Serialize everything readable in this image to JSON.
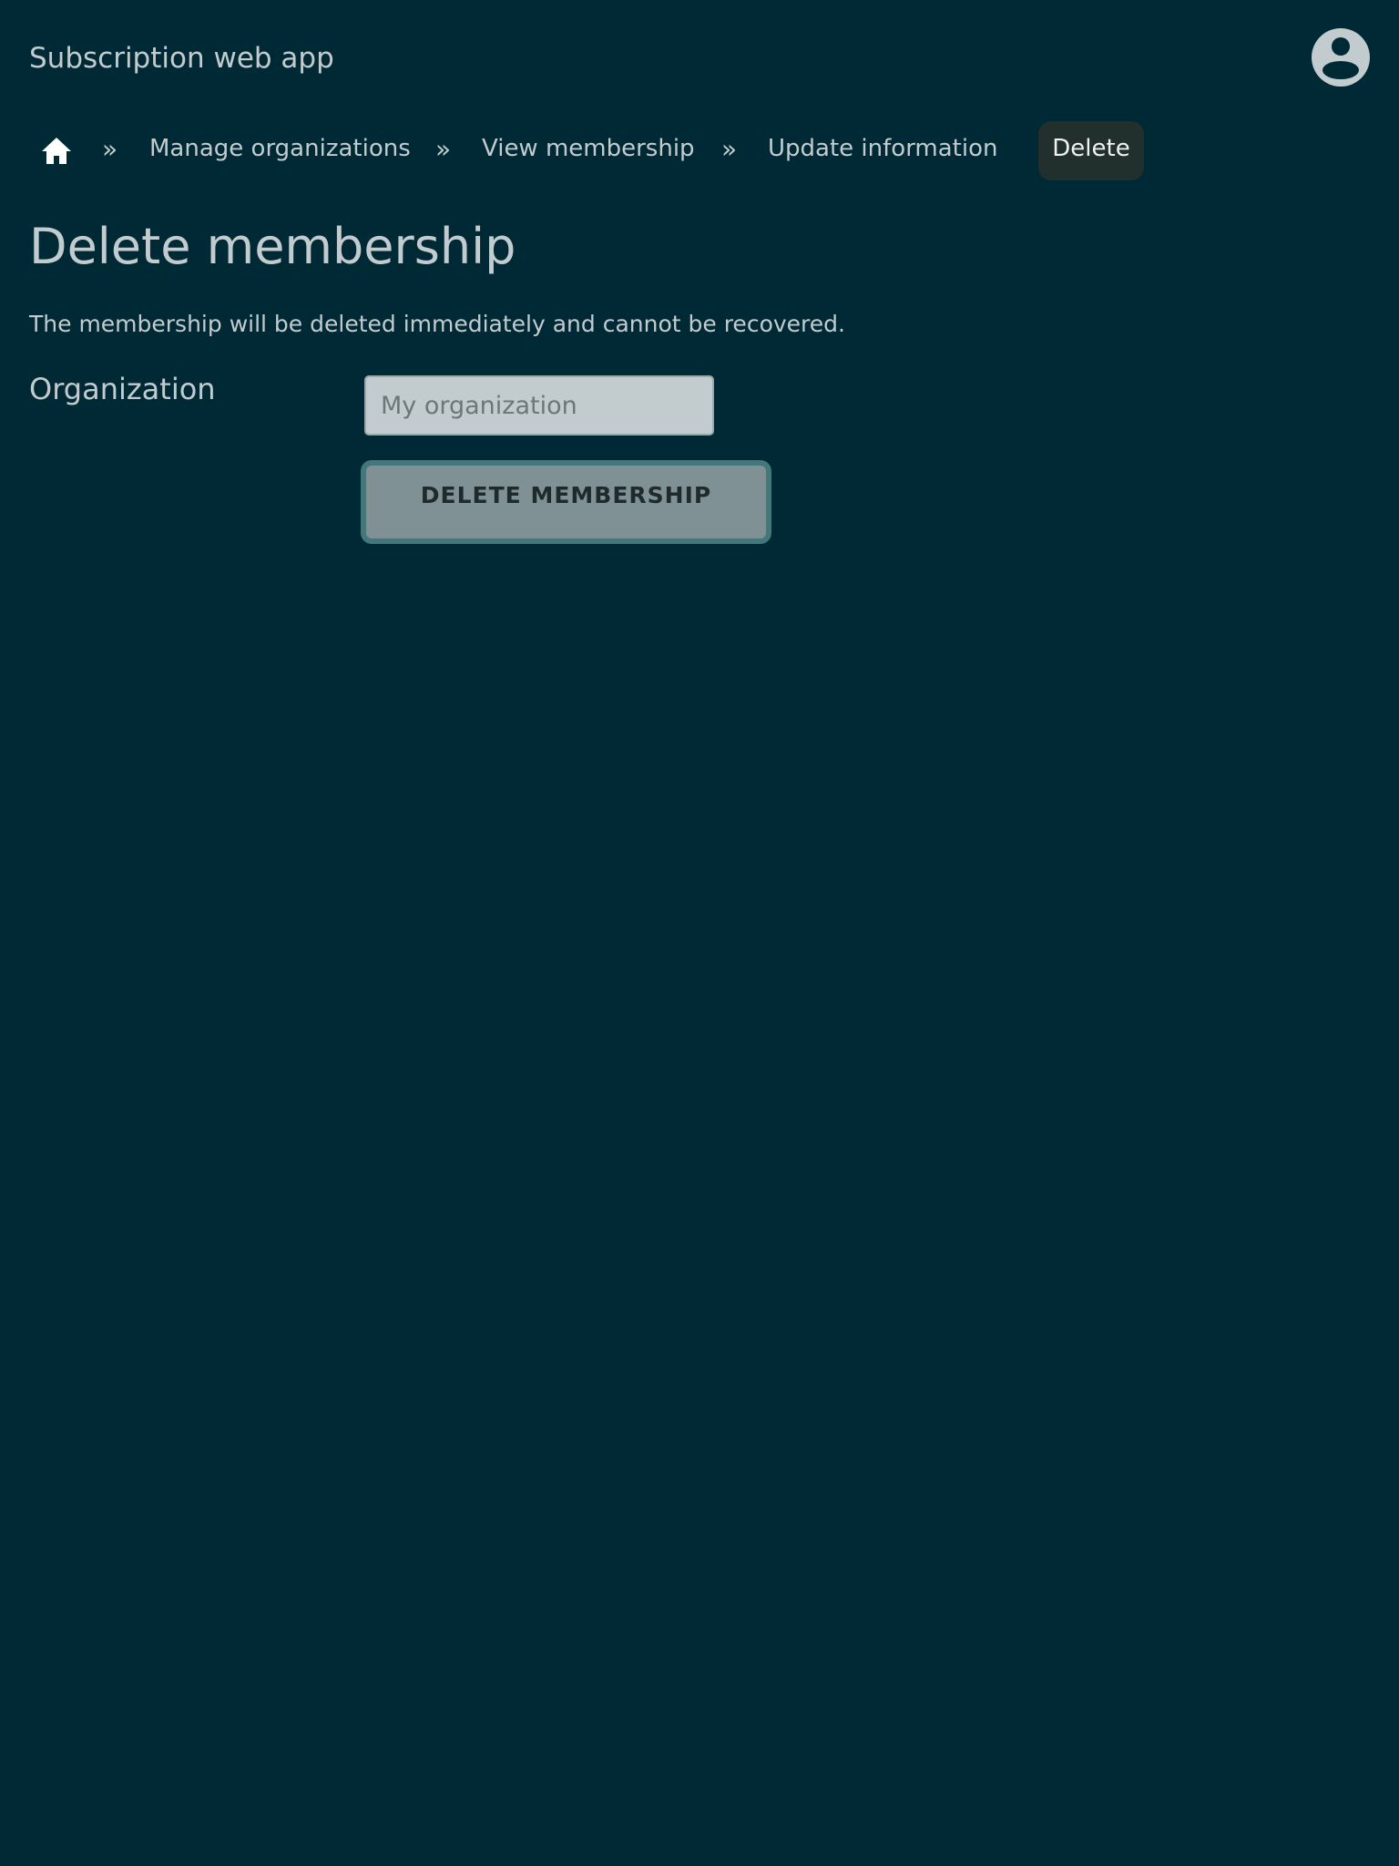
{
  "header": {
    "app_title": "Subscription web app",
    "avatar_icon": "user-circle-icon"
  },
  "breadcrumb": {
    "home_icon": "home-icon",
    "separator": "»",
    "items": [
      {
        "label": "Manage organizations"
      },
      {
        "label": "View membership"
      },
      {
        "label": "Update information"
      }
    ],
    "current": "Delete"
  },
  "main": {
    "title": "Delete membership",
    "warning": "The membership will be deleted immediately and cannot be recovered.",
    "organization_label": "Organization",
    "organization_value": "",
    "organization_placeholder": "My organization",
    "delete_button_label": "DELETE MEMBERSHIP"
  },
  "colors": {
    "background": "#002936",
    "text": "#c2cccf",
    "button_border": "#42787a",
    "button_fill": "#7f9195",
    "current_crumb_bg": "#212f2d"
  }
}
